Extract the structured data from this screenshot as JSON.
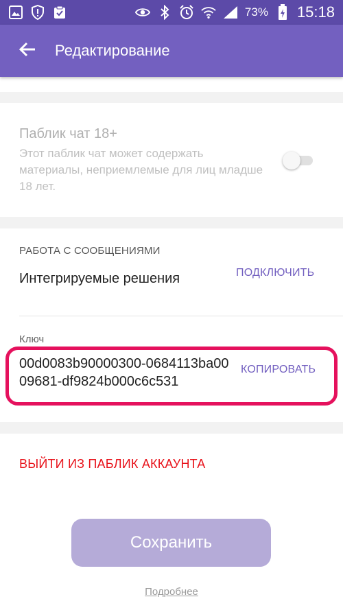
{
  "status_bar": {
    "icons_left": [
      "gallery-icon",
      "shield-alert-icon",
      "clipboard-icon"
    ],
    "icons_right": [
      "eye-icon",
      "bluetooth-icon",
      "alarm-icon",
      "wifi-icon",
      "signal-icon"
    ],
    "battery": "73%",
    "time": "15:18"
  },
  "app_bar": {
    "title": "Редактирование"
  },
  "public_chat": {
    "title": "Паблик чат 18+",
    "description": "Этот паблик чат может содержать материалы, неприемлемые для лиц младше 18 лет.",
    "enabled": false
  },
  "messages": {
    "header": "РАБОТА С СООБЩЕНИЯМИ",
    "integrations_label": "Интегрируемые решения",
    "connect_label": "ПОДКЛЮЧИТЬ",
    "key_label": "Ключ",
    "key_value": "00d0083b90000300-0684113ba0009681-df9824b000c6c531",
    "copy_label": "КОПИРОВАТЬ"
  },
  "actions": {
    "logout_label": "ВЫЙТИ ИЗ ПАБЛИК АККАУНТА",
    "save_label": "Сохранить",
    "more_label": "Подробнее"
  },
  "colors": {
    "status_bar": "#5c4aa8",
    "app_bar": "#7360c0",
    "accent": "#7360c0",
    "danger": "#e8131b",
    "highlight": "#e5115d",
    "save_button": "#b5abd8"
  }
}
